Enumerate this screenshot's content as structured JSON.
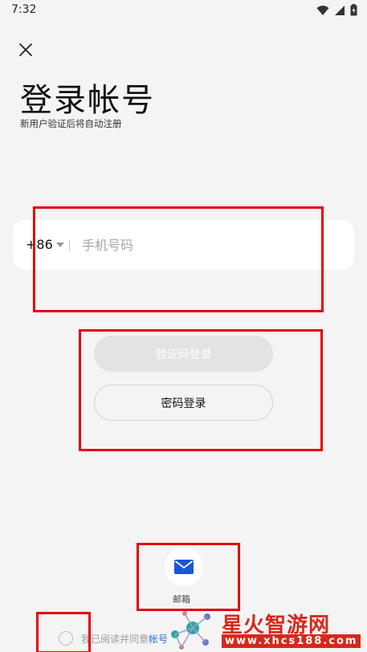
{
  "status_bar": {
    "time": "7:32"
  },
  "header": {
    "title": "登录帐号",
    "subtitle": "新用户验证后将自动注册"
  },
  "phone": {
    "country_code": "+86",
    "placeholder": "手机号码",
    "value": ""
  },
  "buttons": {
    "sms_login": "验证码登录",
    "password_login": "密码登录"
  },
  "alt_login": {
    "email_label": "邮箱"
  },
  "agreement": {
    "text": "我已阅读并同意",
    "link": "帐号"
  },
  "watermark": {
    "name": "星火智游网",
    "url": "www.xhcs188.com"
  },
  "colors": {
    "background": "#f4f4f4",
    "accent": "#2f6fde",
    "highlight": "#e50000",
    "watermark": "#d7281c"
  }
}
